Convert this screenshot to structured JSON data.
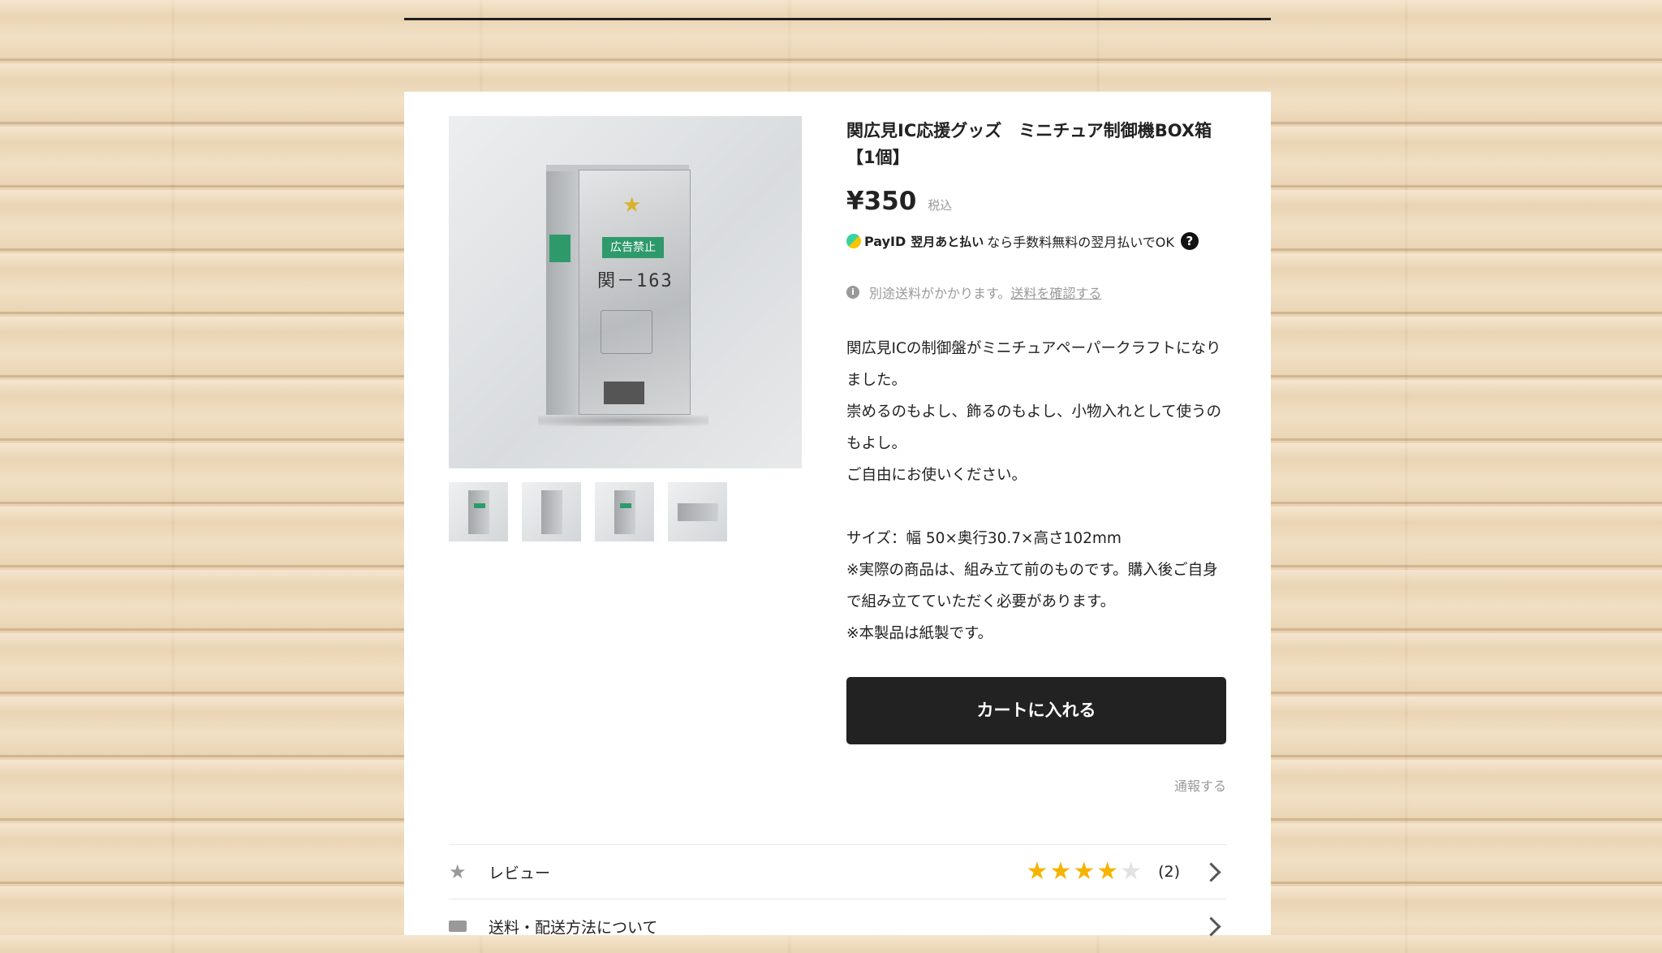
{
  "product": {
    "title": "関広見IC応援グッズ　ミニチュア制御機BOX箱【1個】",
    "price": "¥350",
    "tax_label": "税込",
    "image_text": {
      "label": "広告禁止",
      "code": "関－163"
    }
  },
  "payid": {
    "brand": "PayID",
    "later": "翌月あと払い",
    "text": "なら手数料無料の翌月払いでOK",
    "help": "?"
  },
  "shipping_note": {
    "icon": "i",
    "text": "別途送料がかかります。",
    "link": "送料を確認する"
  },
  "description": [
    "関広見ICの制御盤がミニチュアペーパークラフトになりました。",
    "崇めるのもよし、飾るのもよし、小物入れとして使うのもよし。",
    "ご自由にお使いください。",
    "",
    "サイズ：幅 50×奥行30.7×高さ102mm",
    "※実際の商品は、組み立て前のものです。購入後ご自身で組み立てていただく必要があります。",
    "※本製品は紙製です。"
  ],
  "cart_button": "カートに入れる",
  "report_link": "通報する",
  "rows": {
    "review_label": "レビュー",
    "review_rating": 4,
    "review_max": 5,
    "review_count": "(2)",
    "shipping_label": "送料・配送方法について"
  },
  "icons": {
    "star": "star-icon",
    "truck": "truck-icon",
    "chevron": "chevron-right-icon",
    "info": "info-icon",
    "help": "help-icon"
  },
  "colors": {
    "accent_green": "#2e9a6c",
    "star": "#f5b400",
    "button": "#222222"
  }
}
